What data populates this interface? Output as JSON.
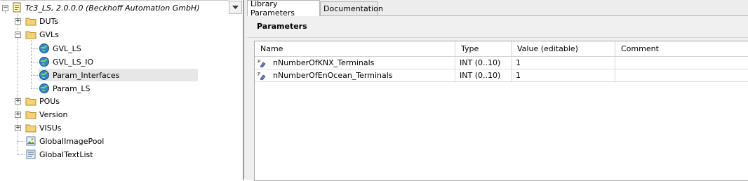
{
  "tree": {
    "root": {
      "label": "Tc3_LS, 2.0.0.0 (Beckhoff Automation GmbH)",
      "icon": "library-root-icon"
    },
    "items": [
      {
        "label": "DUTs",
        "icon": "folder-icon",
        "expander": "+"
      },
      {
        "label": "GVLs",
        "icon": "folder-icon",
        "expander": "−"
      },
      {
        "label": "GVL_LS",
        "icon": "global-variable-list-icon"
      },
      {
        "label": "GVL_LS_IO",
        "icon": "global-variable-list-icon"
      },
      {
        "label": "Param_Interfaces",
        "icon": "global-variable-list-icon",
        "selected": true
      },
      {
        "label": "Param_LS",
        "icon": "global-variable-list-icon"
      },
      {
        "label": "POUs",
        "icon": "folder-icon",
        "expander": "+"
      },
      {
        "label": "Version",
        "icon": "folder-icon",
        "expander": "+"
      },
      {
        "label": "VISUs",
        "icon": "folder-icon",
        "expander": "+"
      },
      {
        "label": "GlobalImagePool",
        "icon": "image-pool-icon"
      },
      {
        "label": "GlobalTextList",
        "icon": "text-list-icon"
      }
    ]
  },
  "tabs": [
    {
      "label": "Library Parameters",
      "active": true
    },
    {
      "label": "Documentation",
      "active": false
    }
  ],
  "parameters": {
    "heading": "Parameters",
    "columns": [
      "Name",
      "Type",
      "Value (editable)",
      "Comment"
    ],
    "rows": [
      {
        "name": "nNumberOfKNX_Terminals",
        "type": "INT (0..10)",
        "value": "1",
        "comment": ""
      },
      {
        "name": "nNumberOfEnOcean_Terminals",
        "type": "INT (0..10)",
        "value": "1",
        "comment": ""
      }
    ]
  },
  "colors": {
    "folder": "#e8c35a",
    "globe": "#1f6fb8",
    "selected_row": "#e7e7e7"
  }
}
